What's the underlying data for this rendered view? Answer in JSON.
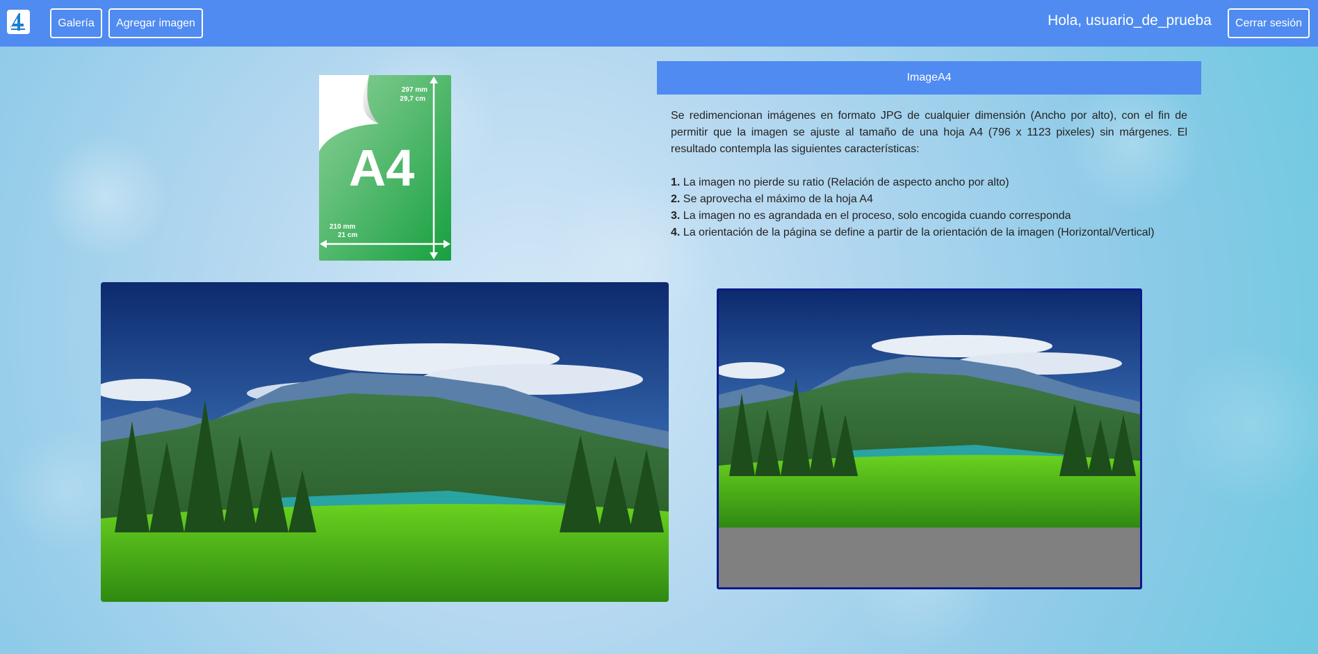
{
  "navbar": {
    "logo_icon": "a4-logo-icon",
    "gallery_label": "Galería",
    "add_image_label": "Agregar imagen",
    "greeting": "Hola, usuario_de_prueba",
    "logout_label": "Cerrar sesión",
    "background_color": "#4f8bf0"
  },
  "a4_illustration": {
    "big_label": "A4",
    "height_mm": "297 mm",
    "height_cm": "29,7 cm",
    "width_mm": "210 mm",
    "width_cm": "21 cm"
  },
  "info_panel": {
    "title": "ImageA4",
    "description": "Se redimencionan imágenes en formato JPG de cualquier dimensión (Ancho por alto), con el fin de permitir que la imagen se ajuste al tamaño de una hoja A4 (796 x 1123 pixeles) sin márgenes. El resultado contempla las siguientes características:",
    "features": [
      {
        "num": "1.",
        "text": "La imagen no pierde su ratio (Relación de aspecto ancho por alto)"
      },
      {
        "num": "2.",
        "text": "Se aprovecha el máximo de la hoja A4"
      },
      {
        "num": "3.",
        "text": "La imagen no es agrandada en el proceso, solo encogida cuando corresponda"
      },
      {
        "num": "4.",
        "text": "La orientación de la página se define a partir de la orientación de la imagen (Horizontal/Vertical)"
      }
    ]
  },
  "images": {
    "original": "landscape-original-image",
    "preview": "landscape-a4-preview-image"
  }
}
